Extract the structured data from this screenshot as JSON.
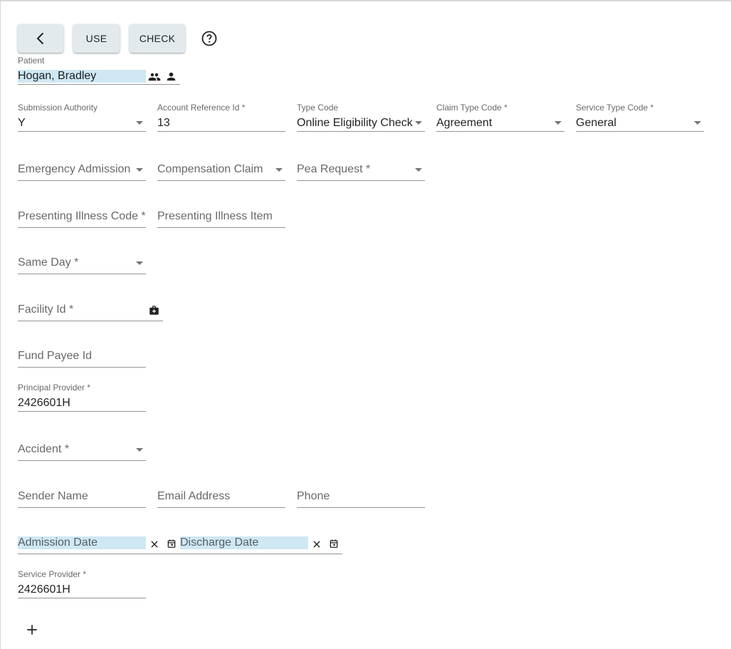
{
  "toolbar": {
    "back_icon": "chevron-left-icon",
    "use_label": "USE",
    "check_label": "CHECK",
    "help_icon": "help-circle-icon"
  },
  "patient": {
    "label": "Patient",
    "value": "Hogan, Bradley",
    "icons": [
      "group-icon",
      "person-icon"
    ]
  },
  "row1": {
    "submission_authority": {
      "label": "Submission Authority",
      "value": "Y"
    },
    "account_reference_id": {
      "label": "Account Reference Id *",
      "value": "13"
    },
    "type_code": {
      "label": "Type Code",
      "value": "Online Eligibility Check"
    },
    "claim_type_code": {
      "label": "Claim Type Code *",
      "value": "Agreement"
    },
    "service_type_code": {
      "label": "Service Type Code *",
      "value": "General"
    }
  },
  "row2": {
    "emergency_admission": {
      "placeholder": "Emergency Admission"
    },
    "compensation_claim": {
      "placeholder": "Compensation Claim"
    },
    "pea_request": {
      "placeholder": "Pea Request *"
    }
  },
  "row3": {
    "presenting_illness_code": {
      "placeholder": "Presenting Illness Code *"
    },
    "presenting_illness_item": {
      "placeholder": "Presenting Illness Item"
    }
  },
  "same_day": {
    "placeholder": "Same Day *"
  },
  "facility_id": {
    "placeholder": "Facility Id *",
    "icon": "medical-bag-icon"
  },
  "fund_payee_id": {
    "placeholder": "Fund Payee Id"
  },
  "principal_provider": {
    "label": "Principal Provider *",
    "value": "2426601H"
  },
  "accident": {
    "placeholder": "Accident *"
  },
  "sender": {
    "sender_name": {
      "placeholder": "Sender Name"
    },
    "email_address": {
      "placeholder": "Email Address"
    },
    "phone": {
      "placeholder": "Phone"
    }
  },
  "dates": {
    "admission_date": {
      "placeholder": "Admission Date"
    },
    "discharge_date": {
      "placeholder": "Discharge Date"
    }
  },
  "service_provider": {
    "label": "Service Provider *",
    "value": "2426601H"
  },
  "add_icon": "plus-icon",
  "colors": {
    "button_bg": "#e3eaed",
    "highlight": "#cfe8f3",
    "underline": "#6b6b6b"
  }
}
